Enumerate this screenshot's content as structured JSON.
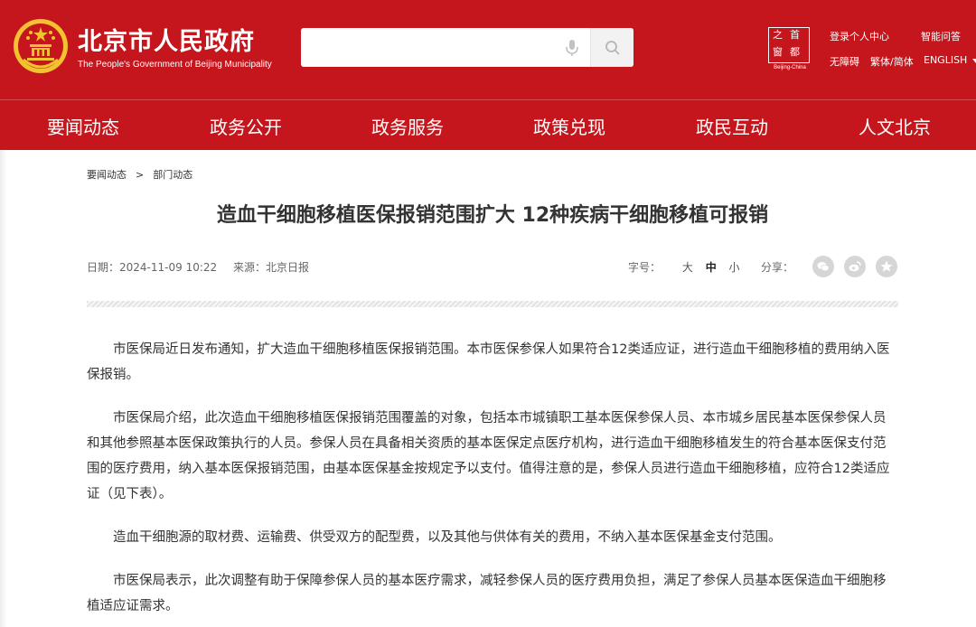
{
  "header": {
    "logo_cn": "北京市人民政府",
    "logo_en": "The People's Government of Beijing Municipality",
    "search_placeholder": "",
    "seal": {
      "chars": [
        "之",
        "首",
        "窗",
        "都"
      ],
      "en": "Beijing-China"
    },
    "links": {
      "login": "登录个人中心",
      "smart_qa": "智能问答",
      "accessibility": "无障碍",
      "traditional_simplified": "繁体/简体",
      "english": "ENGLISH"
    }
  },
  "nav": [
    "要闻动态",
    "政务公开",
    "政务服务",
    "政策兑现",
    "政民互动",
    "人文北京"
  ],
  "breadcrumb": [
    "要闻动态",
    "部门动态"
  ],
  "breadcrumb_sep": ">",
  "article": {
    "title": "造血干细胞移植医保报销范围扩大 12种疾病干细胞移植可报销",
    "date_label": "日期：",
    "date": "2024-11-09 10:22",
    "source_label": "来源：",
    "source": "北京日报",
    "fontsize_label": "字号：",
    "fontsize_options": [
      "大",
      "中",
      "小"
    ],
    "share_label": "分享：",
    "paragraphs": [
      "市医保局近日发布通知，扩大造血干细胞移植医保报销范围。本市医保参保人如果符合12类适应证，进行造血干细胞移植的费用纳入医保报销。",
      "市医保局介绍，此次造血干细胞移植医保报销范围覆盖的对象，包括本市城镇职工基本医保参保人员、本市城乡居民基本医保参保人员和其他参照基本医保政策执行的人员。参保人员在具备相关资质的基本医保定点医疗机构，进行造血干细胞移植发生的符合基本医保支付范围的医疗费用，纳入基本医保报销范围，由基本医保基金按规定予以支付。值得注意的是，参保人员进行造血干细胞移植，应符合12类适应证（见下表）。",
      "造血干细胞源的取材费、运输费、供受双方的配型费，以及其他与供体有关的费用，不纳入基本医保基金支付范围。",
      "市医保局表示，此次调整有助于保障参保人员的基本医疗需求，减轻参保人员的医疗费用负担，满足了参保人员基本医保造血干细胞移植适应证需求。"
    ]
  },
  "icons": {
    "emblem": "national-emblem-icon",
    "mic": "microphone-icon",
    "search": "search-icon",
    "share": [
      "wechat-icon",
      "weibo-icon",
      "star-icon"
    ],
    "dropdown": "caret-down-icon"
  },
  "colors": {
    "brand_red": "#c4161c",
    "emblem_gold": "#f2c230",
    "text": "#333333",
    "meta_text": "#666666",
    "share_bg": "#d6d6d6"
  }
}
